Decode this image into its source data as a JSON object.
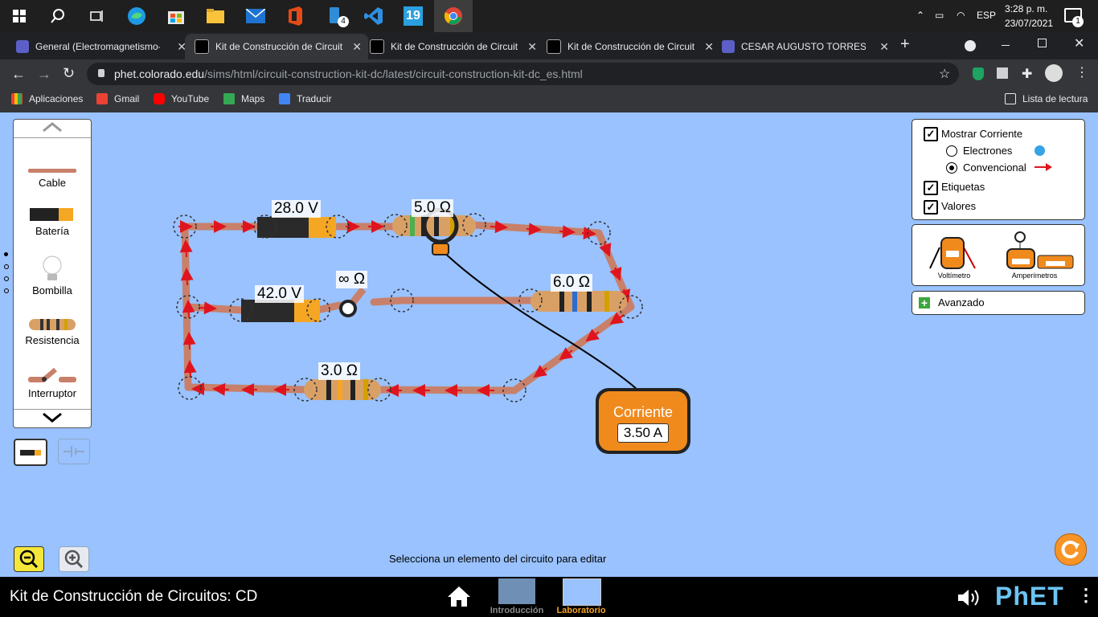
{
  "taskbar": {
    "pinned": [
      "windows-start",
      "search",
      "task-view",
      "edge",
      "store",
      "file-explorer",
      "mail",
      "office",
      "phone",
      "vscode",
      "app-19",
      "chrome"
    ],
    "phone_badge": "4",
    "app19_label": "19",
    "lang": "ESP",
    "time": "3:28 p. m.",
    "date": "23/07/2021",
    "notif_count": "1"
  },
  "browser": {
    "tabs": [
      {
        "title": "General (Electromagnetismo-",
        "active": false
      },
      {
        "title": "Kit de Construcción de Circuit",
        "active": true
      },
      {
        "title": "Kit de Construcción de Circuit",
        "active": false
      },
      {
        "title": "Kit de Construcción de Circuit",
        "active": false
      },
      {
        "title": "CESAR AUGUSTO TORRES OL",
        "active": false
      }
    ],
    "new_tab": "+",
    "url_domain": "phet.colorado.edu",
    "url_path": "/sims/html/circuit-construction-kit-dc/latest/circuit-construction-kit-dc_es.html",
    "bookmarks": [
      "Aplicaciones",
      "Gmail",
      "YouTube",
      "Maps",
      "Traducir"
    ],
    "reading_list": "Lista de lectura"
  },
  "sim": {
    "carousel": [
      "Cable",
      "Batería",
      "Bombilla",
      "Resistencia",
      "Interruptor"
    ],
    "options": {
      "show_current": "Mostrar Corriente",
      "electrons": "Electrones",
      "conventional": "Convencional",
      "labels": "Etiquetas",
      "values": "Valores"
    },
    "tools": {
      "voltmeter": "Voltímetro",
      "ammeters": "Amperímetros"
    },
    "advanced": "Avanzado",
    "components": {
      "battery1": "28.0 V",
      "battery2": "42.0 V",
      "resistor1": "5.0 Ω",
      "resistor2": "6.0 Ω",
      "resistor3": "3.0 Ω",
      "switch": "∞ Ω"
    },
    "ammeter": {
      "title": "Corriente",
      "reading": "3.50 A"
    },
    "status": "Selecciona un elemento del circuito para editar"
  },
  "footer": {
    "title": "Kit de Construcción de Circuitos: CD",
    "screens": [
      "Introducción",
      "Laboratorio"
    ],
    "brand": "PhET"
  },
  "colors": {
    "sim_bg": "#99c2ff",
    "wire": "#c8806a",
    "battery_orange": "#f5a623",
    "arrow": "#e0141e"
  }
}
